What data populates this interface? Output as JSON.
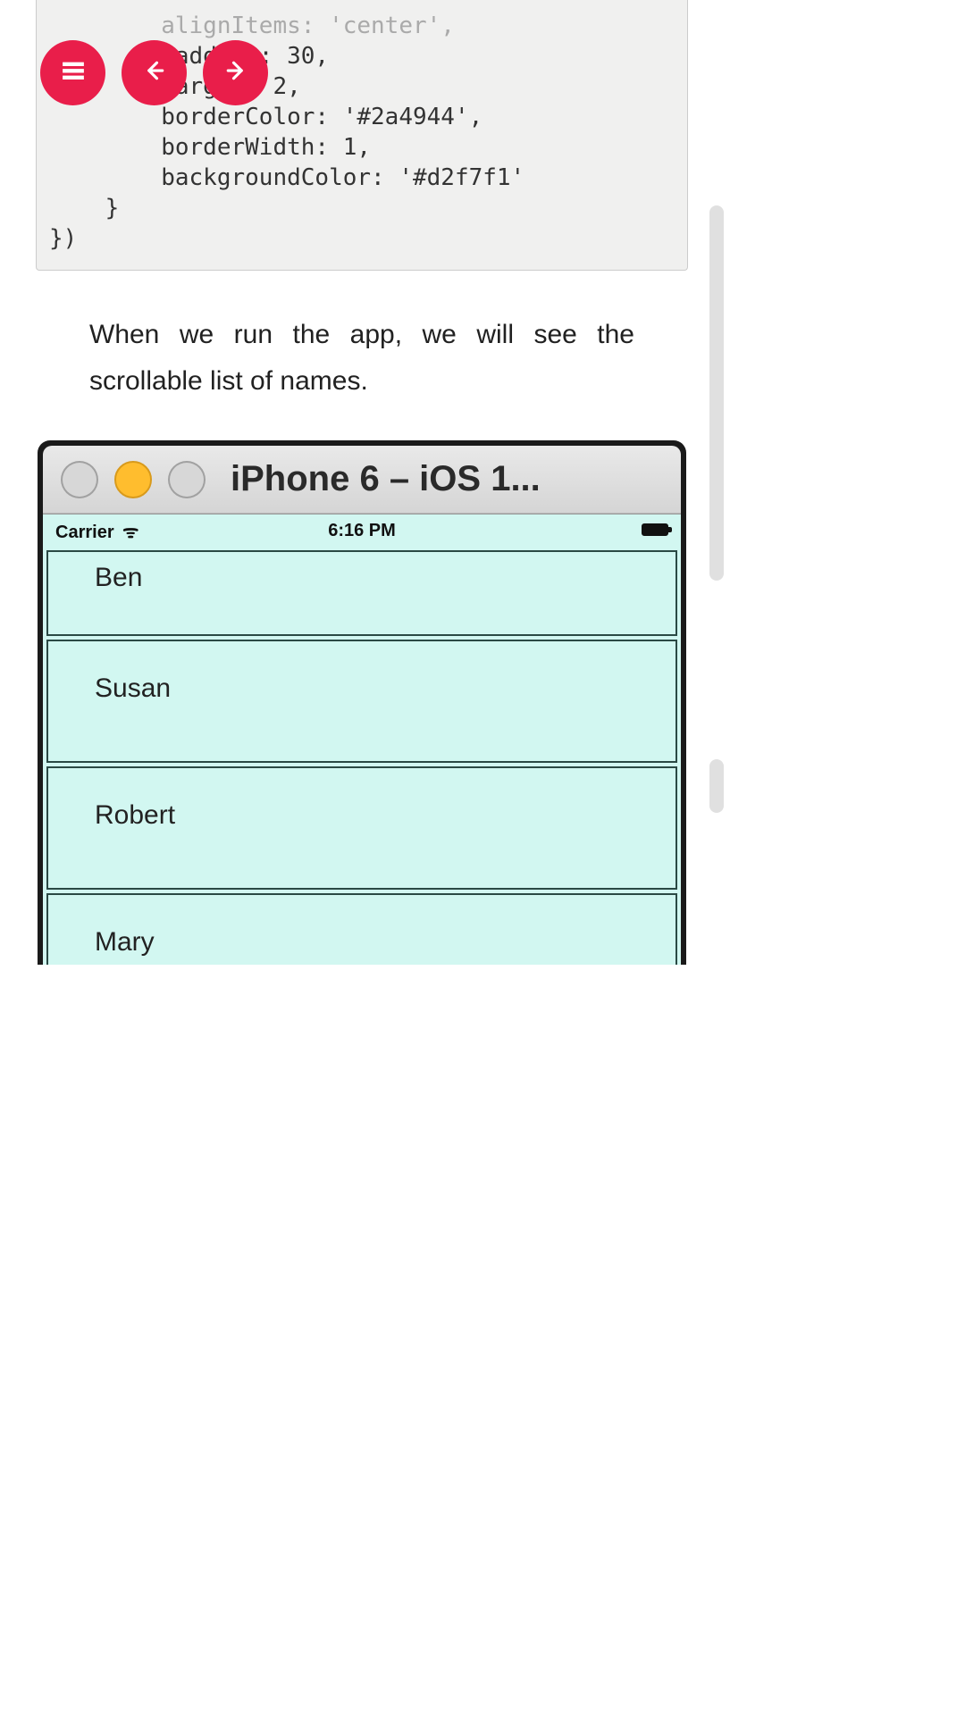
{
  "nav": {
    "menu_label": "menu",
    "prev_label": "previous",
    "next_label": "next"
  },
  "code": {
    "line_faded": "        alignItems: 'center',",
    "line1": "        padding: 30,",
    "line2": "        margin: 2,",
    "line3": "        borderColor: '#2a4944',",
    "line4": "        borderWidth: 1,",
    "line5": "        backgroundColor: '#d2f7f1'",
    "line6": "    }",
    "line7": "})"
  },
  "body_text": "When we run the app, we will see the scrollable list of names.",
  "simulator": {
    "title": "iPhone 6 – iOS 1...",
    "status": {
      "carrier": "Carrier",
      "time": "6:16 PM"
    },
    "list": {
      "item0": "Ben",
      "item1": "Susan",
      "item2": "Robert",
      "item3": "Mary"
    }
  },
  "colors": {
    "accent": "#e91e4a",
    "cell_bg": "#d2f7f1",
    "cell_border": "#2a4944"
  }
}
